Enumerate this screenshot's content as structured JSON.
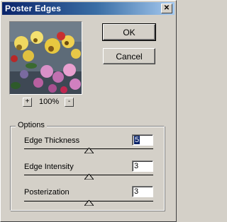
{
  "window": {
    "title": "Poster Edges",
    "close_glyph": "✕"
  },
  "preview": {
    "zoom_in_label": "+",
    "zoom_level": "100%",
    "zoom_out_label": "-"
  },
  "buttons": {
    "ok": "OK",
    "cancel": "Cancel"
  },
  "options": {
    "group_label": "Options",
    "controls": [
      {
        "label": "Edge Thickness",
        "value": "5",
        "slider_fraction": 0.5
      },
      {
        "label": "Edge Intensity",
        "value": "3",
        "slider_fraction": 0.5
      },
      {
        "label": "Posterization",
        "value": "3",
        "slider_fraction": 0.5
      }
    ]
  }
}
